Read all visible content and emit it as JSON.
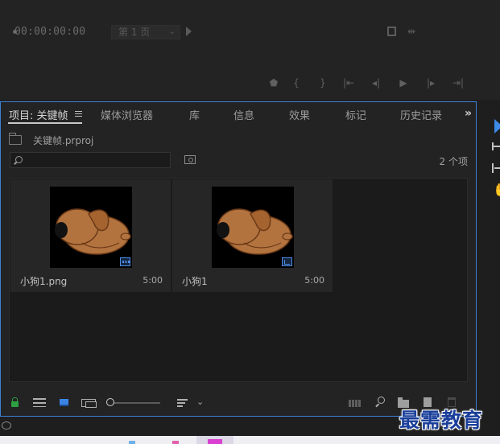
{
  "monitor": {
    "timecode": "00:00:00:00",
    "page_select": "第 1 页"
  },
  "panel": {
    "tabs": [
      {
        "label": "项目: 关键帧",
        "active": true
      },
      {
        "label": "媒体浏览器"
      },
      {
        "label": "库"
      },
      {
        "label": "信息"
      },
      {
        "label": "效果"
      },
      {
        "label": "标记"
      },
      {
        "label": "历史记录"
      }
    ],
    "overflow_label": "»",
    "project_name": "关键帧.prproj",
    "search_placeholder": "",
    "item_count": "2 个项",
    "items": [
      {
        "name": "小狗1.png",
        "duration": "5:00",
        "badge": "still-image-icon"
      },
      {
        "name": "小狗1",
        "duration": "5:00",
        "badge": "sequence-icon"
      }
    ]
  },
  "colors": {
    "accent": "#3d7fd6",
    "lock_green": "#2ea043",
    "dog_body": "#b3733f"
  },
  "watermark": "最需教育"
}
